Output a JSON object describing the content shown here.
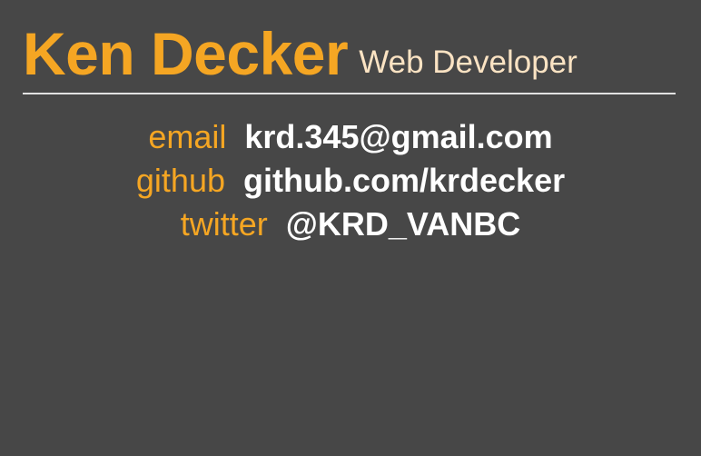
{
  "header": {
    "name": "Ken Decker",
    "role": "Web Developer"
  },
  "contacts": [
    {
      "label": "email",
      "value": "krd.345@gmail.com"
    },
    {
      "label": "github",
      "value": "github.com/krdecker"
    },
    {
      "label": "twitter",
      "value": "@KRD_VANBC"
    }
  ],
  "colors": {
    "background": "#474747",
    "accent": "#f5a623",
    "role_text": "#fbe3c3",
    "value_text": "#ffffff",
    "divider": "#e2e2e2"
  }
}
